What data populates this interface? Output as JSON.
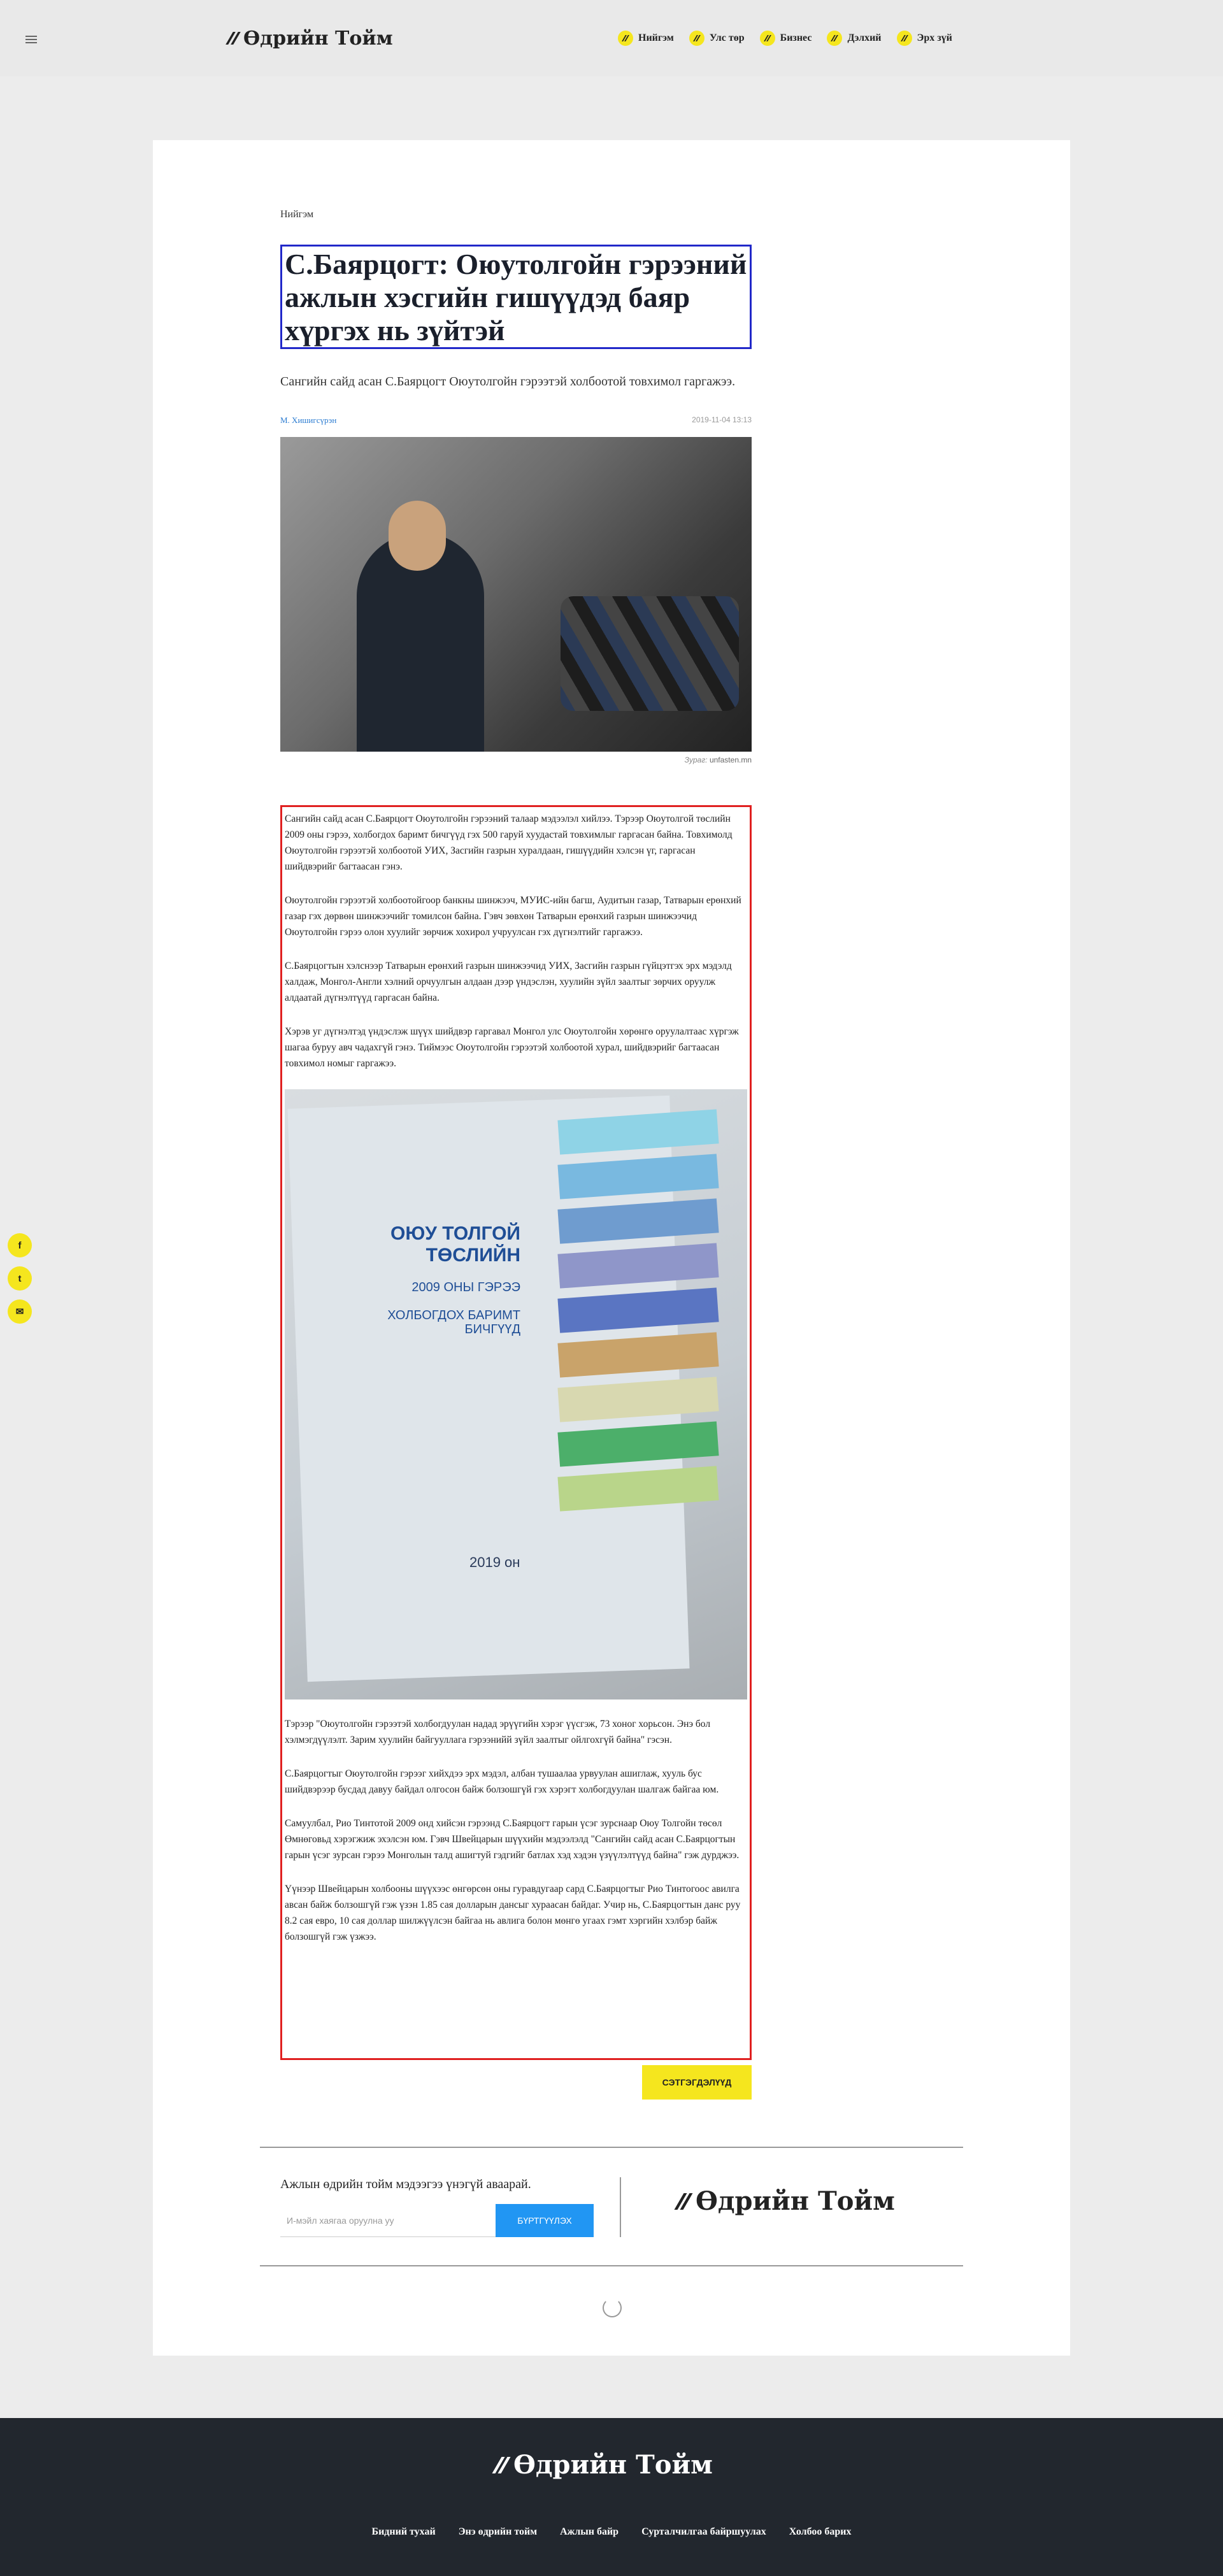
{
  "header": {
    "logo_text": "Өдрийн Тойм",
    "nav": [
      {
        "label": "Нийгэм"
      },
      {
        "label": "Улс төр"
      },
      {
        "label": "Бизнес"
      },
      {
        "label": "Дэлхий"
      },
      {
        "label": "Эрх зүй"
      }
    ]
  },
  "article": {
    "category": "Нийгэм",
    "title": "С.Баярцогт: Оюутолгойн гэрээний ажлын хэсгийн гишүүдэд баяр хүргэх нь зүйтэй",
    "lead": "Сангийн сайд асан С.Баярцогт Оюутолгойн гэрээтэй холбоотой товхимол гаргажээ.",
    "author": "М. Хишигсүрэн",
    "date": "2019-11-04 13:13",
    "photo_caption_label": "Зураг:",
    "photo_caption_source": "unfasten.mn",
    "paragraphs_top": [
      "Сангийн сайд асан С.Баярцогт Оюутолгойн гэрээний талаар мэдээлэл хийлээ. Тэрээр Оюутолгой төслийн 2009 оны гэрээ, холбогдох баримт бичгүүд гэх 500 гаруй хуудастай товхимлыг гаргасан байна. Товхимолд Оюутолгойн гэрээтэй холбоотой УИХ, Засгийн газрын хуралдаан, гишүүдийн хэлсэн үг, гаргасан шийдвэрийг багтаасан гэнэ.",
      "Оюутолгойн гэрээтэй холбоотойгоор банкны шинжээч, МУИС-ийн багш, Аудитын газар, Татварын ерөнхий газар гэх дөрвөн шинжээчийг томилсон байна. Гэвч зөвхөн Татварын ерөнхий газрын шинжээчид Оюутолгойн гэрээ олон хуулийг зөрчиж хохирол учруулсан гэх дүгнэлтийг гаргажээ.",
      "С.Баярцогтын хэлснээр Татварын ерөнхий газрын шинжээчид УИХ, Засгийн газрын гүйцэтгэх эрх мэдэлд халдаж, Монгол-Англи хэлний орчуулгын алдаан дээр үндэслэн, хуулийн зүйл заалтыг зөрчих оруулж алдаатай дүгнэлтүүд гаргасан байна.",
      "Хэрэв уг дүгнэлтэд үндэслэж шүүх шийдвэр гаргавал Монгол улс Оюутолгойн хөрөнгө оруулалтаас хүргэж шагаа буруу авч чадахгүй гэнэ. Тиймээс Оюутолгойн гэрээтэй холбоотой хурал, шийдвэрийг багтаасан товхимол номыг гаргажээ."
    ],
    "doc_image": {
      "title": "ОЮУ ТОЛГОЙ ТӨСЛИЙН",
      "subtitle_line1": "2009 ОНЫ ГЭРЭЭ",
      "subtitle_line2": "ХОЛБОГДОХ БАРИМТ БИЧГҮҮД",
      "year": "2019 он"
    },
    "paragraphs_bottom": [
      "Тэрээр \"Оюутолгойн гэрээтэй холбогдуулан надад эрүүгийн хэрэг үүсгэж, 73 хоног хорьсон. Энэ бол хэлмэгдүүлэлт. Зарим хуулийн байгууллага гэрээнийй зүйл заалтыг ойлгохгүй байна\" гэсэн.",
      "С.Баярцогтыг Оюутолгойн гэрээг хийхдээ эрх мэдэл, албан тушаалаа урвуулан ашиглаж, хууль бус шийдвэрээр бусдад давуу байдал олгосон байж болзошгүй гэх хэрэгт холбогдуулан шалгаж байгаа юм.",
      "Самуулбал, Рио Тинтотой 2009 онд хийсэн гэрээнд С.Баярцогт гарын үсэг зурснаар Оюу Толгойн төсөл Өмнөговьд хэрэгжиж эхэлсэн юм. Гэвч Швейцарын шүүхийн мэдээлэлд \"Сангийн сайд асан С.Баярцогтын гарын үсэг зурсан гэрээ Монголын талд ашигтуй гэдгийг батлах хэд хэдэн үзүүлэлтүүд байна\" гэж дурджээ.",
      "Үүнээр Швейцарын холбооны шүүхээс өнгөрсөн оны гуравдугаар сард С.Баярцогтыг Рио Тинтогоос авилга авсан байж болзошгүй гэж үзэн 1.85 сая долларын дансыг хураасан байдаг. Учир нь, С.Баярцогтын данс руу 8.2 сая евро, 10 сая доллар шилжүүлсэн байгаа нь авлига болон мөнгө угаах гэмт хэргийн хэлбэр байж болзошгүй гэж үзжээ."
    ],
    "tags_button": "СЭТГЭГДЭЛҮҮД"
  },
  "newsletter": {
    "label": "Ажлын өдрийн тойм мэдээгээ үнэгүй аваарай.",
    "placeholder": "И-мэйл хаягаа оруулна уу",
    "submit": "БҮРТГҮҮЛЭХ",
    "logo_text": "Өдрийн Тойм"
  },
  "social": [
    {
      "label": "f",
      "icon": "facebook-icon"
    },
    {
      "label": "t",
      "icon": "twitter-icon"
    },
    {
      "label": "✉",
      "icon": "email-icon"
    }
  ],
  "footer": {
    "logo_text": "Өдрийн Тойм",
    "links": [
      {
        "label": "Бидний тухай"
      },
      {
        "label": "Энэ өдрийн тойм"
      },
      {
        "label": "Ажлын байр"
      },
      {
        "label": "Сурталчилгаа байршуулах"
      },
      {
        "label": "Холбоо барих"
      }
    ]
  },
  "colors": {
    "accent_yellow": "#f5e61e",
    "title_box_border": "#2128c9",
    "body_box_border": "#e02020",
    "link_blue": "#2a7bd1",
    "button_blue": "#2196f3",
    "footer_bg": "#22272e"
  }
}
